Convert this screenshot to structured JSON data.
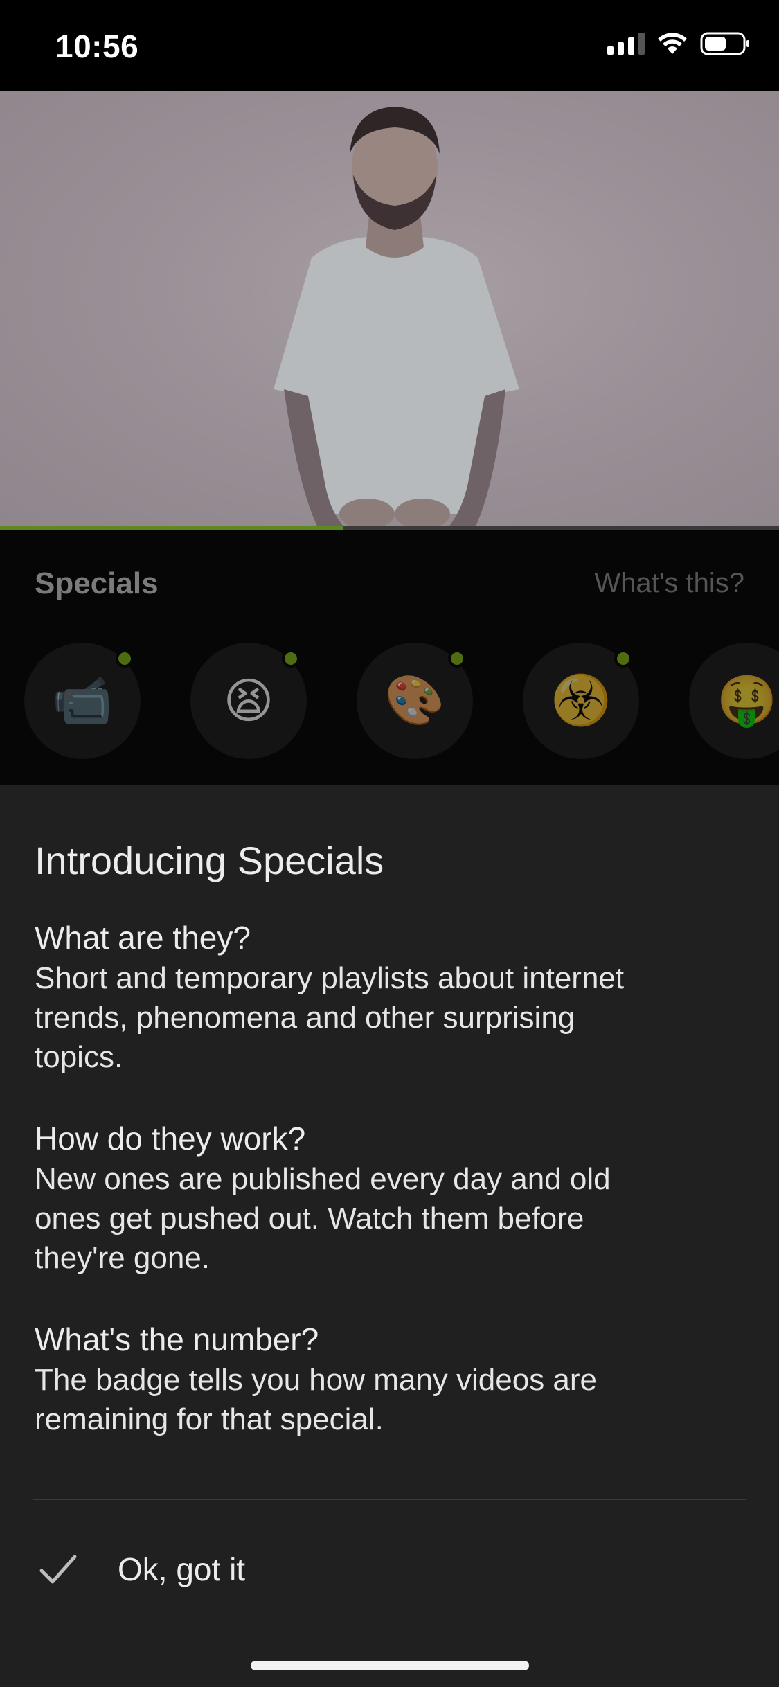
{
  "status_bar": {
    "time": "10:56"
  },
  "video": {
    "progress_percent": 44
  },
  "specials": {
    "title": "Specials",
    "whats_this_link": "What's this?",
    "items": [
      {
        "icon": "video-camera-icon",
        "emoji": "📹",
        "has_new": true
      },
      {
        "icon": "tired-face-icon",
        "emoji": "😫",
        "has_new": true
      },
      {
        "icon": "palette-icon",
        "emoji": "🎨",
        "has_new": true
      },
      {
        "icon": "biohazard-icon",
        "emoji": "☣️",
        "has_new": true
      },
      {
        "icon": "money-mouth-face-icon",
        "emoji": "🤑",
        "has_new": false
      }
    ]
  },
  "sheet": {
    "title": "Introducing Specials",
    "sections": [
      {
        "question": "What are they?",
        "answer_lines": [
          "Short and temporary playlists about internet",
          "trends, phenomena and other surprising",
          "topics."
        ]
      },
      {
        "question": "How do they work?",
        "answer_lines": [
          "New ones are published every day and old",
          "ones get pushed out. Watch them before",
          "they're gone."
        ]
      },
      {
        "question": "What's the number?",
        "answer_lines": [
          "The badge tells you how many videos are",
          "remaining for that special."
        ]
      }
    ],
    "ok_label": "Ok, got it"
  },
  "colors": {
    "accent": "#5f8a1b",
    "sheet_background": "#202020"
  }
}
